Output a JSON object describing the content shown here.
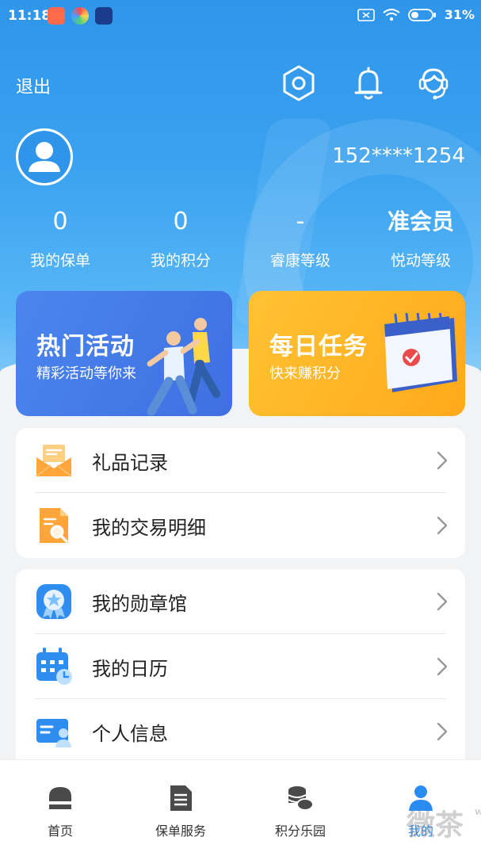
{
  "status_bar": {
    "time": "11:18",
    "battery": "31%"
  },
  "header": {
    "logout_label": "退出"
  },
  "profile": {
    "phone": "152****1254"
  },
  "stats": [
    {
      "value": "0",
      "label": "我的保单"
    },
    {
      "value": "0",
      "label": "我的积分"
    },
    {
      "value": "-",
      "label": "睿康等级"
    },
    {
      "value": "准会员",
      "label": "悦动等级"
    }
  ],
  "promo": {
    "hot": {
      "title": "热门活动",
      "subtitle": "精彩活动等你来"
    },
    "task": {
      "title": "每日任务",
      "subtitle": "快来赚积分"
    }
  },
  "menu_group1": [
    {
      "label": "礼品记录",
      "icon": "gift-envelope-icon"
    },
    {
      "label": "我的交易明细",
      "icon": "transaction-doc-icon"
    }
  ],
  "menu_group2": [
    {
      "label": "我的勋章馆",
      "icon": "medal-icon"
    },
    {
      "label": "我的日历",
      "icon": "calendar-icon"
    },
    {
      "label": "个人信息",
      "icon": "id-card-icon"
    }
  ],
  "tabbar": [
    {
      "label": "首页",
      "icon": "home-icon"
    },
    {
      "label": "保单服务",
      "icon": "policy-doc-icon"
    },
    {
      "label": "积分乐园",
      "icon": "coins-icon"
    },
    {
      "label": "我的",
      "icon": "person-icon",
      "active": true
    }
  ],
  "watermark": {
    "text": "微茶",
    "sub": "WXCHA"
  },
  "colors": {
    "brand_blue": "#2f95ea",
    "task_orange": "#ffac1f",
    "active_tab": "#2a8cf0"
  }
}
